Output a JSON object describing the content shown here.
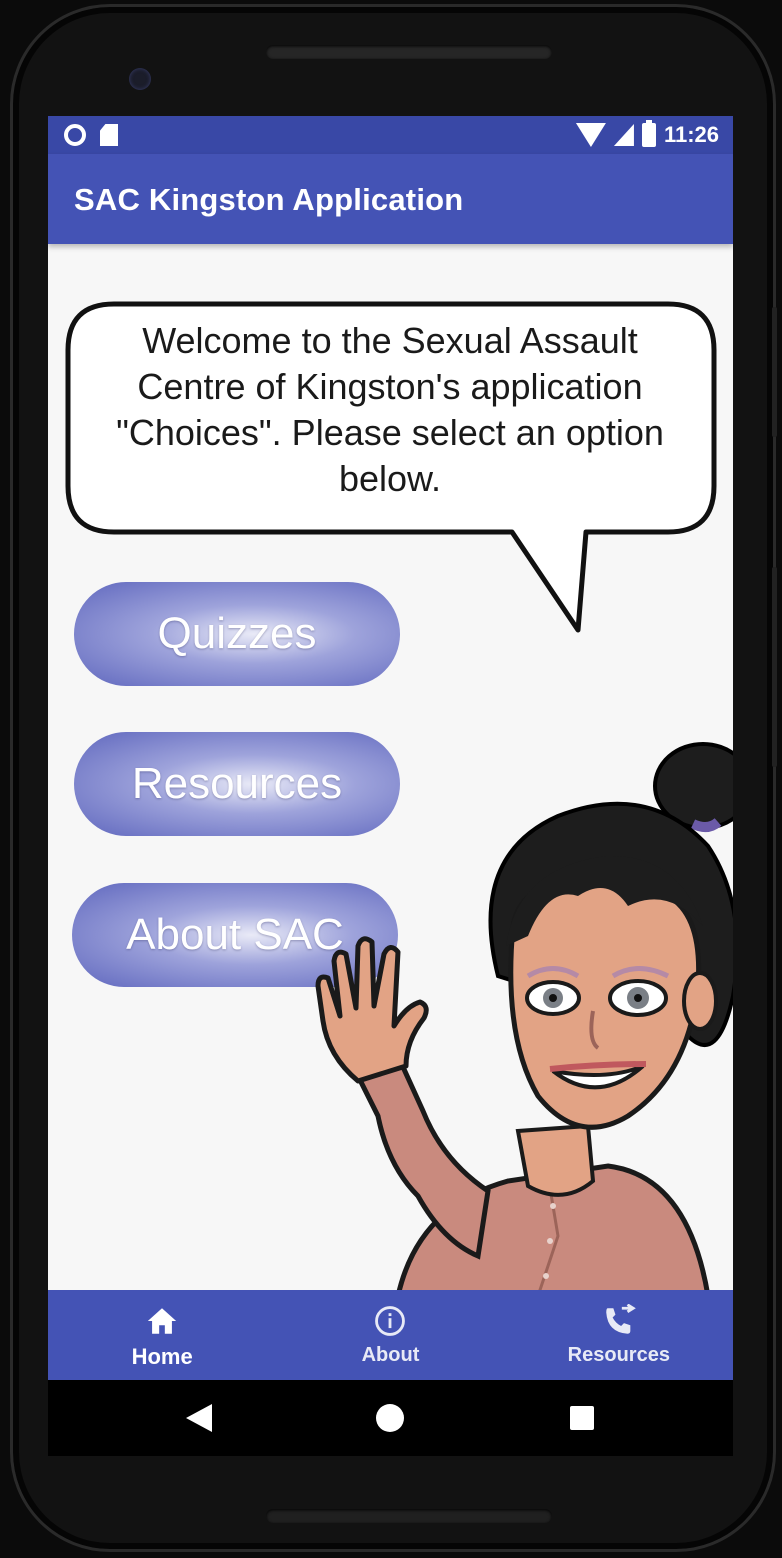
{
  "status_bar": {
    "time": "11:26",
    "icons": [
      "notification-dot-icon",
      "sd-card-icon",
      "wifi-icon",
      "signal-icon",
      "battery-icon"
    ]
  },
  "app_bar": {
    "title": "SAC Kingston Application",
    "color": "#4453b5"
  },
  "welcome": {
    "message": "Welcome to the Sexual Assault Centre of Kingston's application \"Choices\". Please select an option below."
  },
  "menu": {
    "buttons": [
      {
        "label": "Quizzes"
      },
      {
        "label": "Resources"
      },
      {
        "label": "About SAC"
      }
    ]
  },
  "bottom_nav": {
    "items": [
      {
        "label": "Home",
        "icon": "home-icon",
        "active": true
      },
      {
        "label": "About",
        "icon": "info-icon",
        "active": false
      },
      {
        "label": "Resources",
        "icon": "phone-forward-icon",
        "active": false
      }
    ]
  },
  "system_nav": {
    "icons": [
      "back-icon",
      "home-circle-icon",
      "recents-icon"
    ]
  }
}
